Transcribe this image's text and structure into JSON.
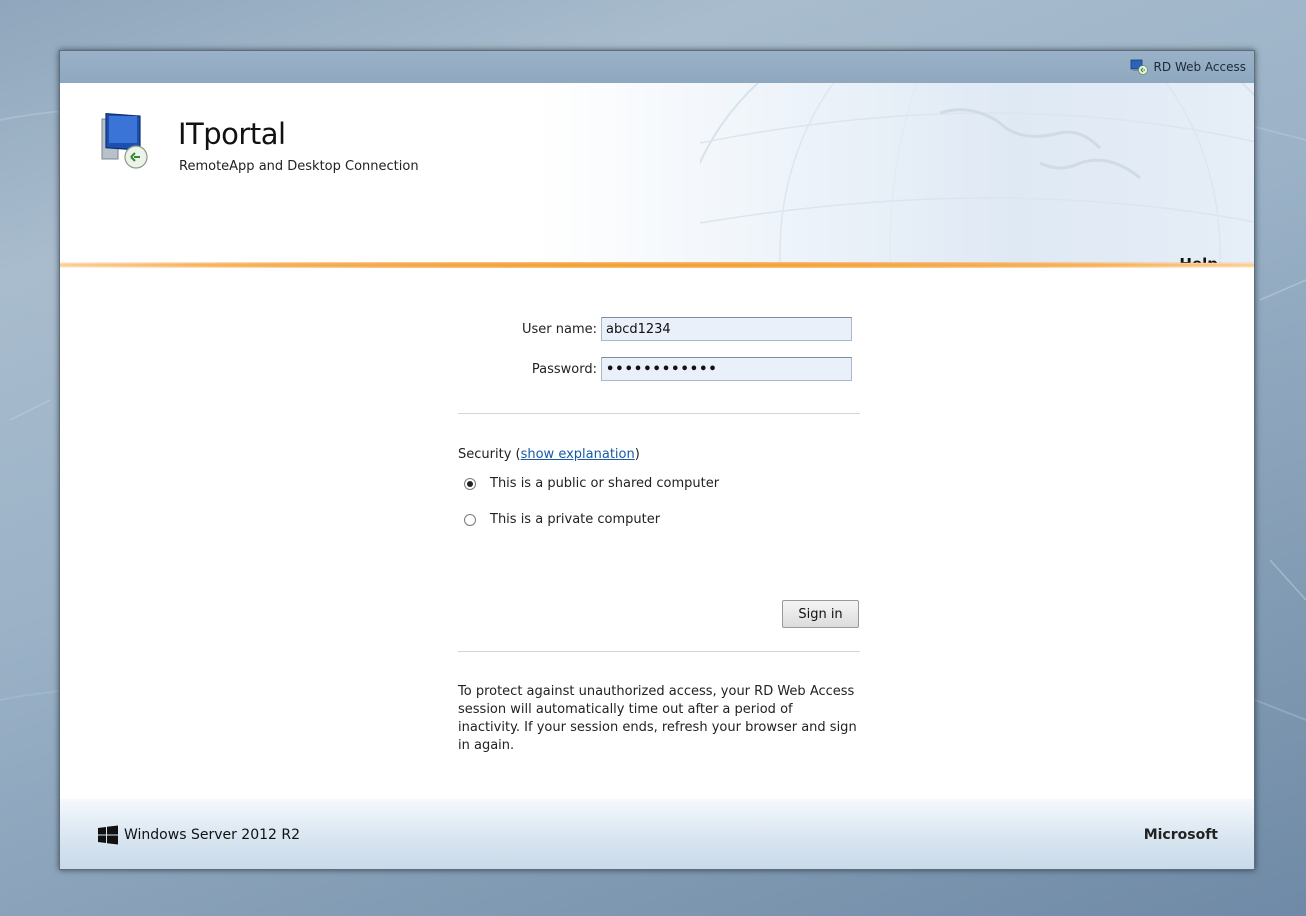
{
  "topbar": {
    "rd_web_access_label": "RD Web Access",
    "icon": "rd-web-access-icon"
  },
  "header": {
    "title": "ITportal",
    "subtitle": "RemoteApp and Desktop Connection",
    "help_label": "Help",
    "logo_icon": "remote-desktop-icon"
  },
  "form": {
    "username_label": "User name:",
    "username_value": "abcd1234",
    "password_label": "Password:",
    "password_value": "••••••••••••",
    "security_prefix": "Security (",
    "security_link": "show explanation",
    "security_suffix": ")",
    "radio_public_label": "This is a public or shared computer",
    "radio_private_label": "This is a private computer",
    "selected_option": "public",
    "signin_label": "Sign in",
    "notice": "To protect against unauthorized access, your RD Web Access session will automatically time out after a period of inactivity. If your session ends, refresh your browser and sign in again."
  },
  "footer": {
    "windows_label": "Windows Server 2012 R2",
    "microsoft_label": "Microsoft",
    "windows_icon": "windows-logo-icon"
  },
  "colors": {
    "accent_orange": "#f39a2b",
    "link_blue": "#1a5aa8",
    "field_bg": "#e9f0fa"
  }
}
